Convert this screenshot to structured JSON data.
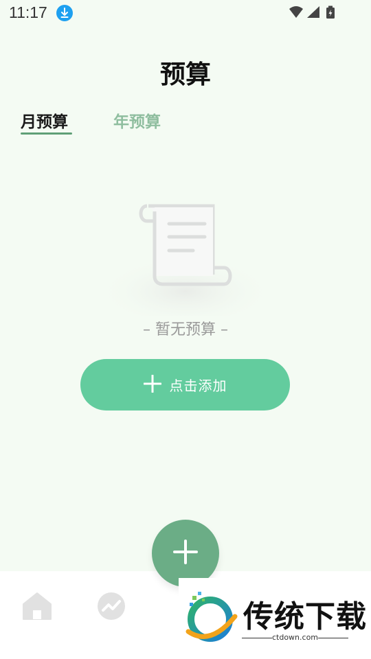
{
  "status_bar": {
    "time": "11:17"
  },
  "header": {
    "title": "预算"
  },
  "tabs": [
    {
      "label": "月预算",
      "active": true
    },
    {
      "label": "年预算",
      "active": false
    }
  ],
  "empty_state": {
    "text": "– 暂无预算 –"
  },
  "add_button": {
    "label": "点击添加"
  },
  "bottom_nav": {
    "items": [
      {
        "icon": "home-icon"
      },
      {
        "icon": "chart-trend-icon"
      }
    ],
    "fab_icon": "plus-icon"
  },
  "watermark": {
    "title": "传统下载",
    "url": "ctdown.com"
  },
  "colors": {
    "background": "#f4fbf3",
    "accent": "#63cc9e",
    "fab": "#6bad86",
    "tab_inactive": "#8fbe9f"
  }
}
